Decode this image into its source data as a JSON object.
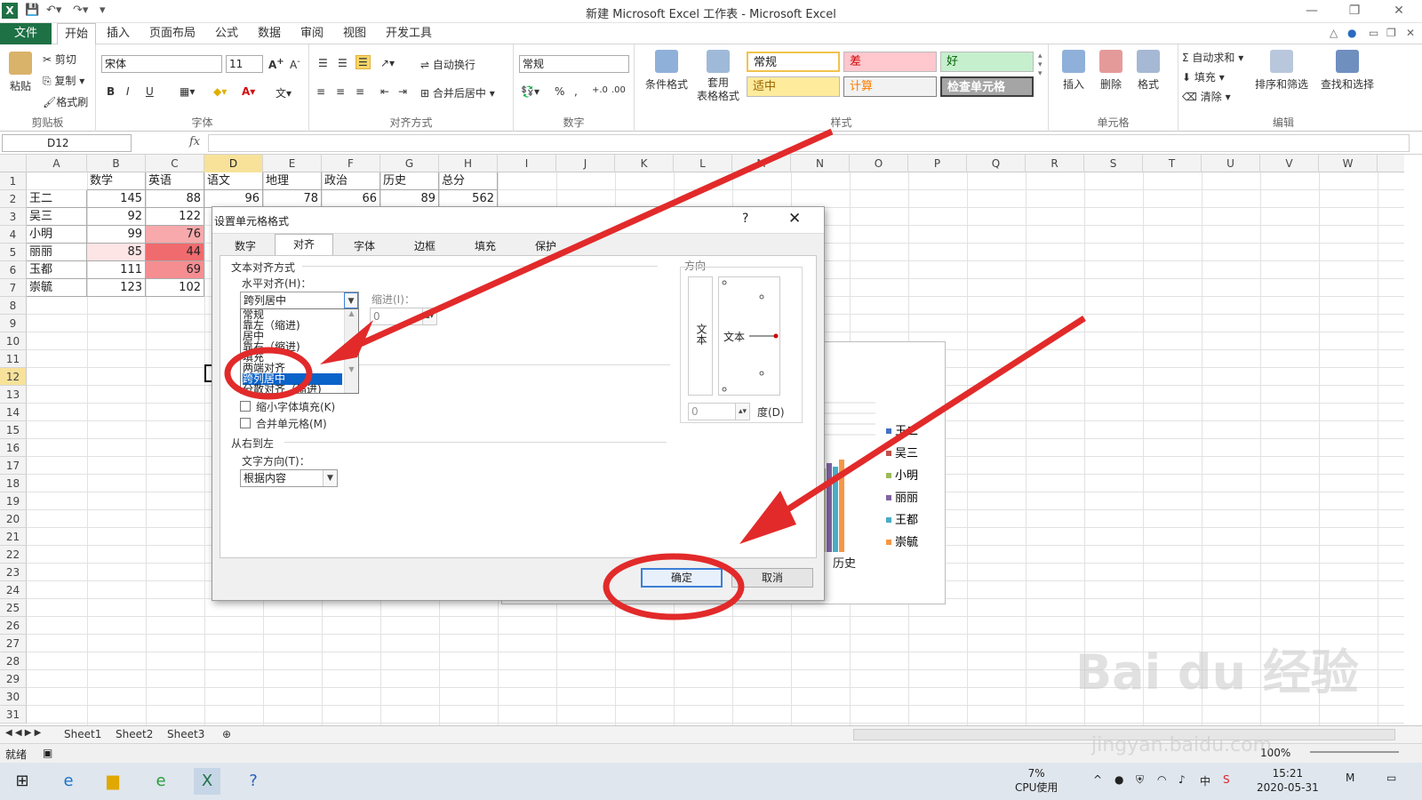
{
  "window": {
    "title": "新建 Microsoft Excel 工作表 - Microsoft Excel"
  },
  "tabs": {
    "file": "文件",
    "home": "开始",
    "insert": "插入",
    "layout": "页面布局",
    "formula": "公式",
    "data": "数据",
    "review": "审阅",
    "view": "视图",
    "dev": "开发工具"
  },
  "ribbon": {
    "clipboard": {
      "paste": "粘贴",
      "cut": "剪切",
      "copy": "复制",
      "format_painter": "格式刷",
      "label": "剪贴板"
    },
    "font": {
      "name": "宋体",
      "size": "11",
      "bold": "B",
      "italic": "I",
      "underline": "U",
      "label": "字体"
    },
    "alignment": {
      "wrap": "自动换行",
      "merge": "合并后居中",
      "label": "对齐方式"
    },
    "number": {
      "format": "常规",
      "percent": "%",
      "comma": ",",
      "label": "数字"
    },
    "styles": {
      "conditional": "条件格式",
      "table_line1": "套用",
      "table_line2": "表格格式",
      "normal": "常规",
      "bad": "差",
      "good": "好",
      "neutral": "适中",
      "calc": "计算",
      "check": "检查单元格",
      "label": "样式"
    },
    "cells": {
      "insert": "插入",
      "delete": "删除",
      "format": "格式",
      "label": "单元格"
    },
    "editing": {
      "autosum": "自动求和",
      "fill": "填充",
      "clear": "清除",
      "sort": "排序和筛选",
      "find": "查找和选择",
      "label": "编辑"
    }
  },
  "namebox": "D12",
  "fx": "fx",
  "columns": [
    "A",
    "B",
    "C",
    "D",
    "E",
    "F",
    "G",
    "H",
    "I",
    "J",
    "K",
    "L",
    "M",
    "N",
    "O",
    "P",
    "Q",
    "R",
    "S",
    "T",
    "U",
    "V",
    "W"
  ],
  "rows": [
    "1",
    "2",
    "3",
    "4",
    "5",
    "6",
    "7",
    "8",
    "9",
    "10",
    "11",
    "12",
    "13",
    "14",
    "15",
    "16",
    "17",
    "18",
    "19",
    "20",
    "21",
    "22",
    "23",
    "24",
    "25",
    "26",
    "27",
    "28",
    "29",
    "30",
    "31"
  ],
  "sheet": {
    "headers": [
      "",
      "数学",
      "英语",
      "语文",
      "地理",
      "政治",
      "历史",
      "总分"
    ],
    "row2": [
      "王二",
      "145",
      "88",
      "96",
      "78",
      "66",
      "89",
      "562"
    ],
    "names": [
      "吴三",
      "小明",
      "丽丽",
      "玉都",
      "崇毓"
    ],
    "math": [
      "92",
      "99",
      "85",
      "111",
      "123"
    ],
    "english": [
      "122",
      "76",
      "44",
      "69",
      "102"
    ]
  },
  "chart": {
    "legend": [
      "王二",
      "吴三",
      "小明",
      "丽丽",
      "王都",
      "崇毓"
    ],
    "xlabel": "历史",
    "colors": [
      "#4472c4",
      "#c0504d",
      "#9bbb59",
      "#8064a2",
      "#4bacc6",
      "#f79646"
    ]
  },
  "dialog": {
    "title": "设置单元格格式",
    "help": "?",
    "close": "✕",
    "tabs": [
      "数字",
      "对齐",
      "字体",
      "边框",
      "填充",
      "保护"
    ],
    "section_align": "文本对齐方式",
    "h_align_label": "水平对齐(H)：",
    "h_align_value": "跨列居中",
    "indent_label": "缩进(I)：",
    "indent_value": "0",
    "list_items": [
      "常规",
      "靠左（缩进)",
      "居中",
      "靠右（缩进)",
      "填充",
      "两端对齐",
      "跨列居中",
      "分散对齐（缩进)"
    ],
    "shrink": "缩小字体填充(K)",
    "merge": "合并单元格(M)",
    "rtl_section": "从右到左",
    "text_dir_label": "文字方向(T)：",
    "text_dir_value": "根据内容",
    "orient_label": "方向",
    "orient_vertical": "文本",
    "orient_horizontal": "文本",
    "degree_value": "0",
    "degree_label": "度(D)",
    "ok": "确定",
    "cancel": "取消"
  },
  "sheets": [
    "Sheet1",
    "Sheet2",
    "Sheet3"
  ],
  "status": {
    "ready": "就绪",
    "zoom": "100%"
  },
  "taskbar": {
    "cpu_pct": "7%",
    "cpu_label": "CPU使用",
    "time": "15:21",
    "date": "2020-05-31",
    "ime": "中"
  },
  "watermark": {
    "brand": "Bai du 经验",
    "url": "jingyan.baidu.com"
  }
}
